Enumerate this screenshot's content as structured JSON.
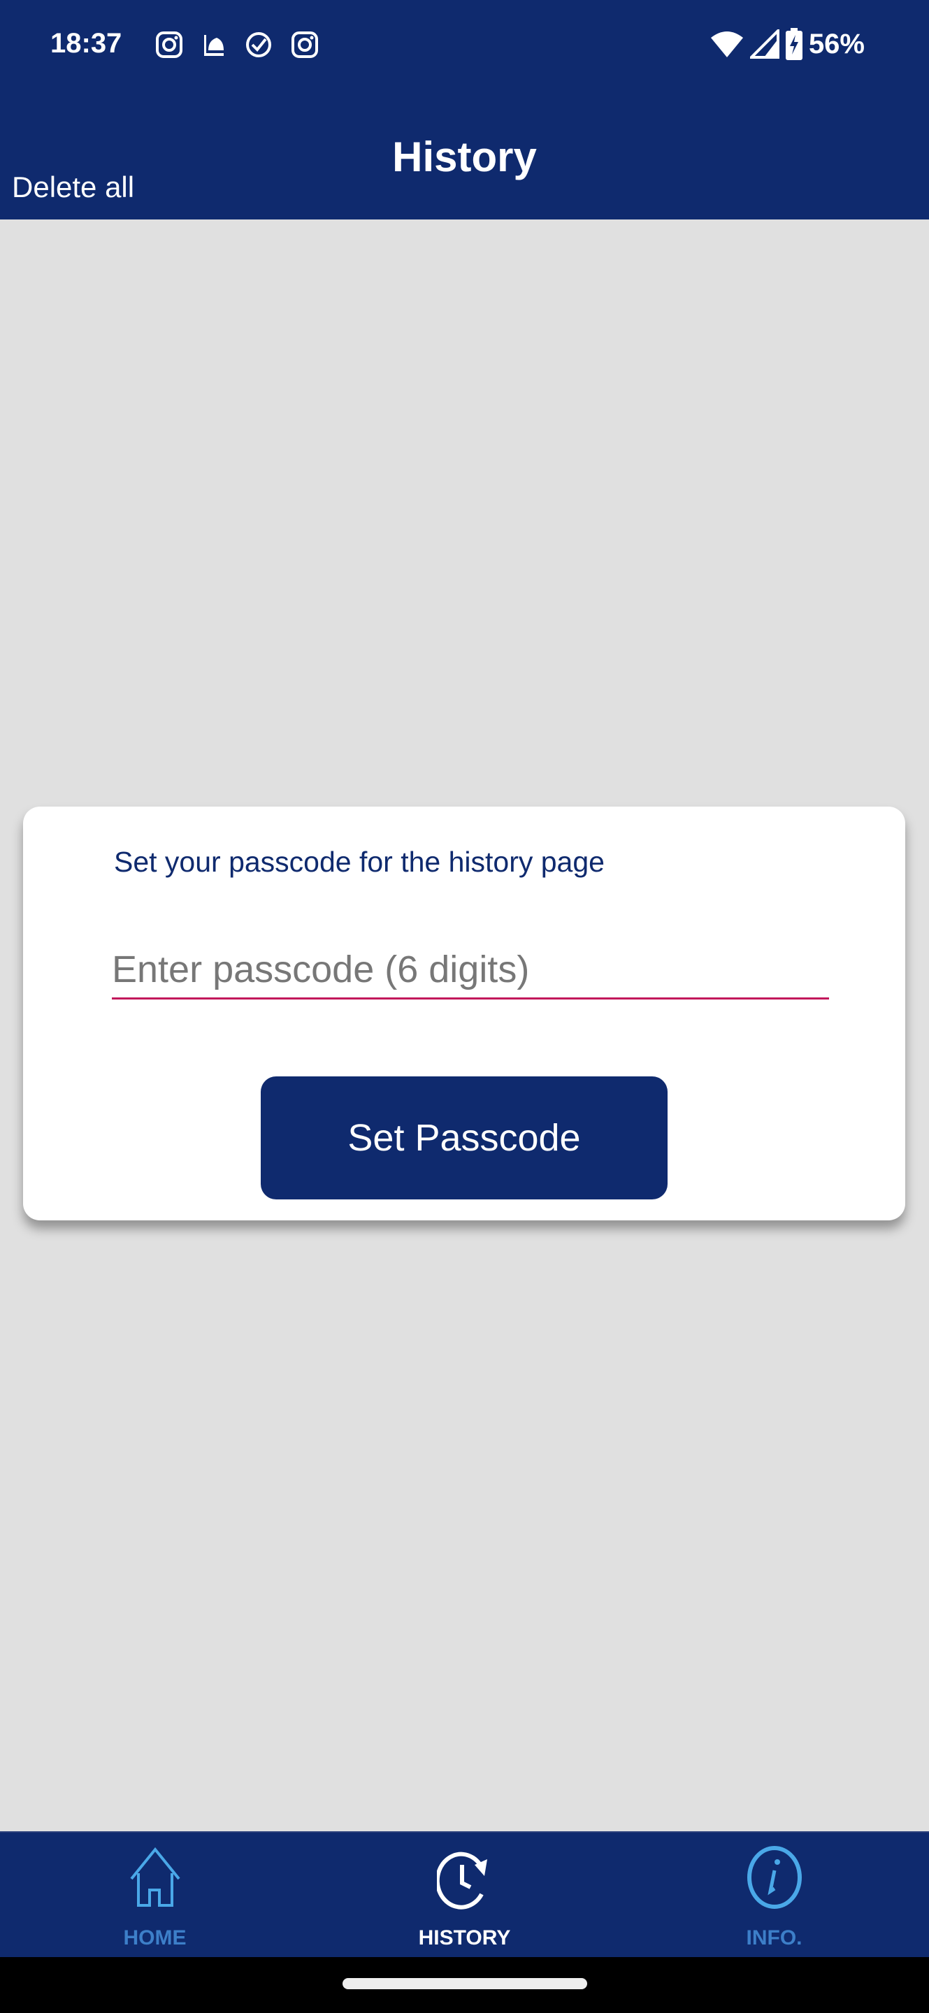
{
  "status_bar": {
    "time": "18:37",
    "left_icons": [
      "instagram-icon",
      "mosque-app-icon",
      "check-circle-icon",
      "instagram-icon"
    ],
    "right_icons": [
      "wifi-icon",
      "cellular-signal-icon",
      "battery-charging-icon"
    ],
    "battery": "56%"
  },
  "header": {
    "title": "History",
    "delete_all_label": "Delete all"
  },
  "dialog": {
    "label": "Set your passcode for the history page",
    "input_value": "",
    "input_placeholder": "Enter passcode (6 digits)",
    "button_label": "Set Passcode"
  },
  "bottom_nav": {
    "items": [
      {
        "label": "HOME",
        "icon": "home-icon",
        "active": false
      },
      {
        "label": "HISTORY",
        "icon": "history-icon",
        "active": true
      },
      {
        "label": "INFO.",
        "icon": "info-icon",
        "active": false
      }
    ]
  },
  "colors": {
    "primary": "#0f2a6e",
    "background": "#e0e0e0",
    "input_underline": "#c2185b",
    "inactive_nav": "#3d7fc9",
    "nav_icon_light": "#4aa8e8"
  }
}
